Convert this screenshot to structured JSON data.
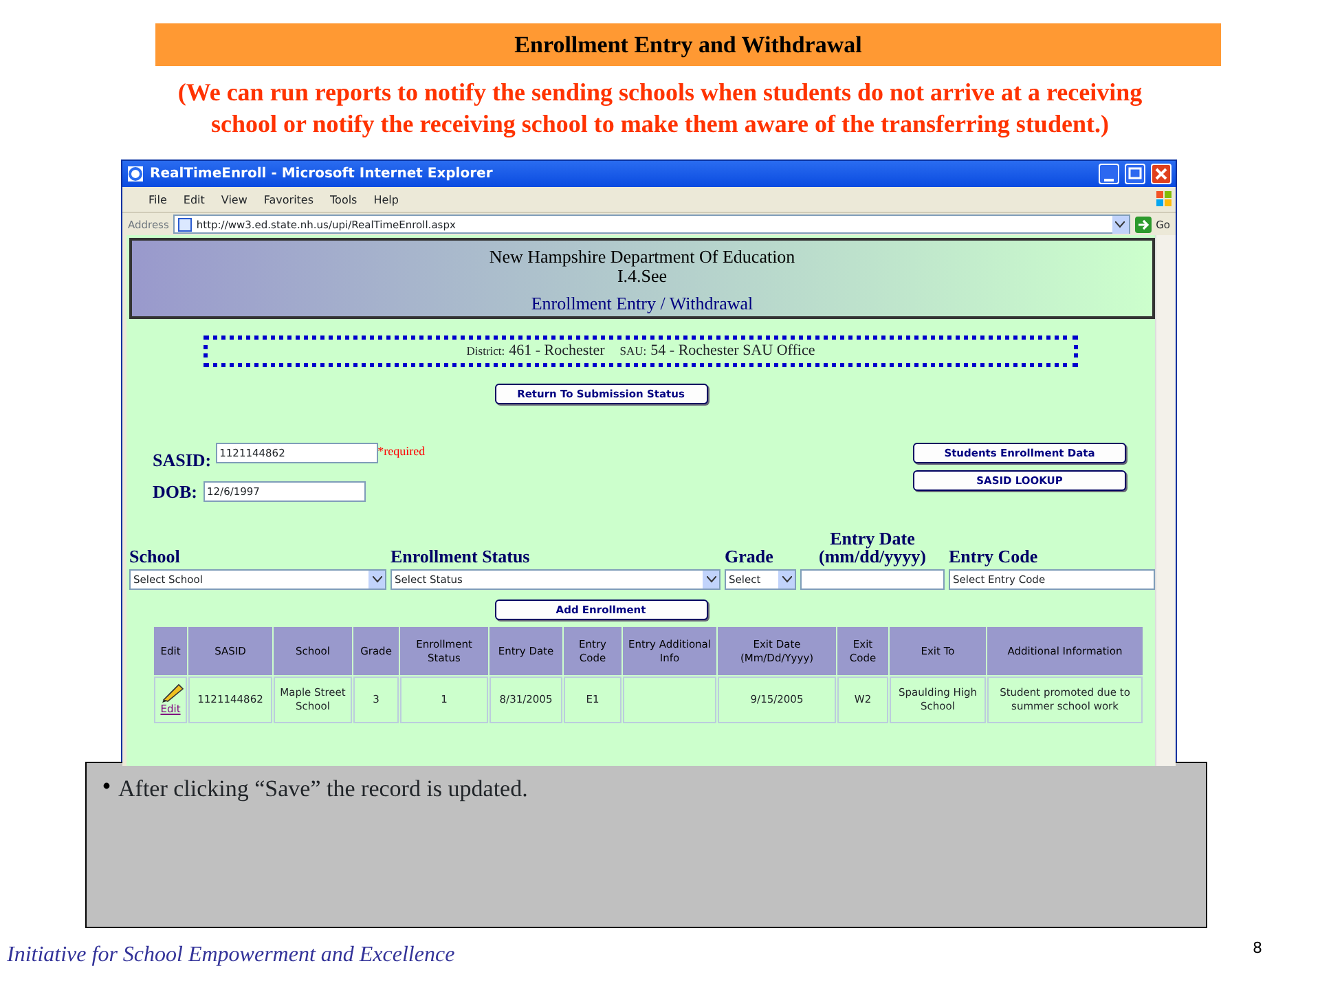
{
  "slide": {
    "title": "Enrollment Entry and Withdrawal",
    "subtitle_lines": [
      "(We can run reports to notify the sending schools when students do not arrive at a receiving",
      "school or notify the receiving school to make them aware of the transferring student.)"
    ]
  },
  "browser": {
    "title": "RealTimeEnroll - Microsoft Internet Explorer",
    "menu": [
      "File",
      "Edit",
      "View",
      "Favorites",
      "Tools",
      "Help"
    ],
    "address_label": "Address",
    "url": "http://ww3.ed.state.nh.us/upi/RealTimeEnroll.aspx",
    "go_label": "Go"
  },
  "page": {
    "header_lines": [
      "New Hampshire Department Of Education",
      "I.4.See",
      "Enrollment Entry / Withdrawal"
    ],
    "district_label": "District:",
    "district": "461 - Rochester",
    "sau_label": "SAU:",
    "sau": "54 - Rochester SAU Office",
    "return_button": "Return To Submission Status",
    "sasid_label": "SASID:",
    "sasid_value": "1121144862",
    "required": "*required",
    "dob_label": "DOB:",
    "dob_value": "12/6/1997",
    "side_buttons": [
      "Students Enrollment Data",
      "SASID LOOKUP"
    ],
    "filters": [
      {
        "label": "School",
        "kind": "select",
        "value": "Select School"
      },
      {
        "label": "Enrollment Status",
        "kind": "select",
        "value": "Select Status"
      },
      {
        "label": "Grade",
        "kind": "select",
        "value": "Select"
      },
      {
        "label": "Entry Date (mm/dd/yyyy)",
        "kind": "input"
      },
      {
        "label": "Entry Code",
        "kind": "input",
        "value": "Select Entry Code"
      }
    ],
    "add_button": "Add Enrollment",
    "table": {
      "columns": [
        "Edit",
        "SASID",
        "School",
        "Grade",
        "Enrollment Status",
        "Entry Date",
        "Entry Code",
        "Entry Additional Info",
        "Exit Date (Mm/Dd/Yyyy)",
        "Exit Code",
        "Exit To",
        "Additional Information"
      ],
      "rows": [
        {
          "cells": [
            "Edit",
            "1121144862",
            "Maple Street School",
            "3",
            "1",
            "8/31/2005",
            "E1",
            null,
            "9/15/2005",
            "W2",
            "Spaulding High School",
            "Student promoted due to summer school work"
          ]
        }
      ]
    }
  },
  "note": "After clicking “Save” the record is updated.",
  "footer": "Initiative for School Empowerment and Excellence",
  "page_number": "8"
}
